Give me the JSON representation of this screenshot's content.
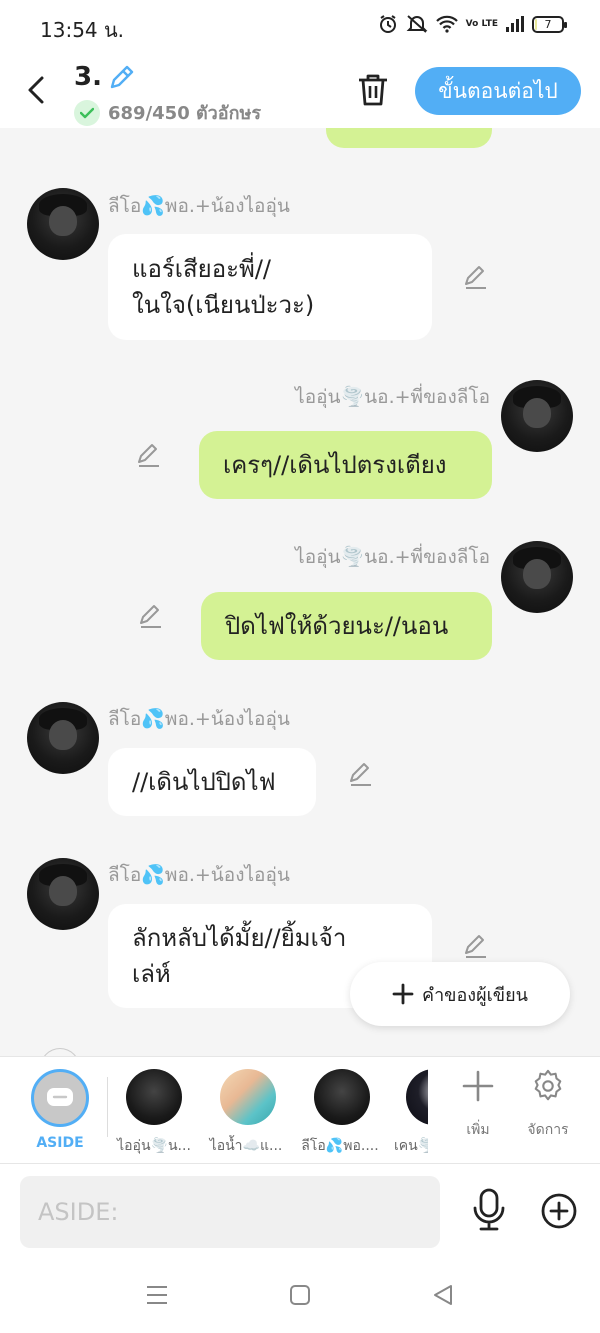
{
  "status": {
    "time": "13:54 น.",
    "network": "Vo LTE",
    "battery": "7",
    "battery_level": 0.07
  },
  "header": {
    "title": "3.",
    "char_count": "689/450 ตัวอักษร",
    "next_button": "ขั้นตอนต่อไป"
  },
  "messages": [
    {
      "side": "left",
      "name": "ลีโอ💦พอ.+น้องไออุ่น",
      "lines": [
        "แอร์เสียอะพี่//",
        "ในใจ(เนียนป่ะวะ)"
      ]
    },
    {
      "side": "right",
      "name": "ไออุ่น🌪️นอ.+พี่ของลีโอ",
      "lines": [
        "เครๆ//เดินไปตรงเตียง"
      ]
    },
    {
      "side": "right",
      "name": "ไออุ่น🌪️นอ.+พี่ของลีโอ",
      "lines": [
        "ปิดไฟให้ด้วยนะ//นอน"
      ]
    },
    {
      "side": "left",
      "name": "ลีโอ💦พอ.+น้องไออุ่น",
      "lines": [
        "//เดินไปปิดไฟ"
      ]
    },
    {
      "side": "left",
      "name": "ลีโอ💦พอ.+น้องไออุ่น",
      "lines": [
        "ลักหลับได้มั้ย//ยิ้มเจ้า",
        "เล่ห์"
      ]
    }
  ],
  "author_button": "คำของผู้เขียน",
  "characters": {
    "aside_label": "ASIDE",
    "items": [
      {
        "label": "ไออุ่น🌪️น..."
      },
      {
        "label": "ไอน้ำ☁️แ..."
      },
      {
        "label": "ลีโอ💦พอ...."
      },
      {
        "label": "เคน🌪️"
      }
    ],
    "add_label": "เพิ่ม",
    "manage_label": "จัดการ"
  },
  "input": {
    "placeholder": "ASIDE:"
  },
  "icons": {
    "back": "back-arrow-icon",
    "edit": "pencil-icon",
    "check": "check-icon",
    "trash": "trash-icon",
    "plus": "plus-icon",
    "gear": "gear-icon",
    "mic": "microphone-icon",
    "add": "plus-circle-icon",
    "menu": "menu-icon",
    "home": "home-icon",
    "back_nav": "back-triangle-icon"
  },
  "colors": {
    "accent": "#52aef5",
    "my_bubble": "#d4f294",
    "other_bubble": "#ffffff",
    "check_green": "#3cbf5a"
  }
}
